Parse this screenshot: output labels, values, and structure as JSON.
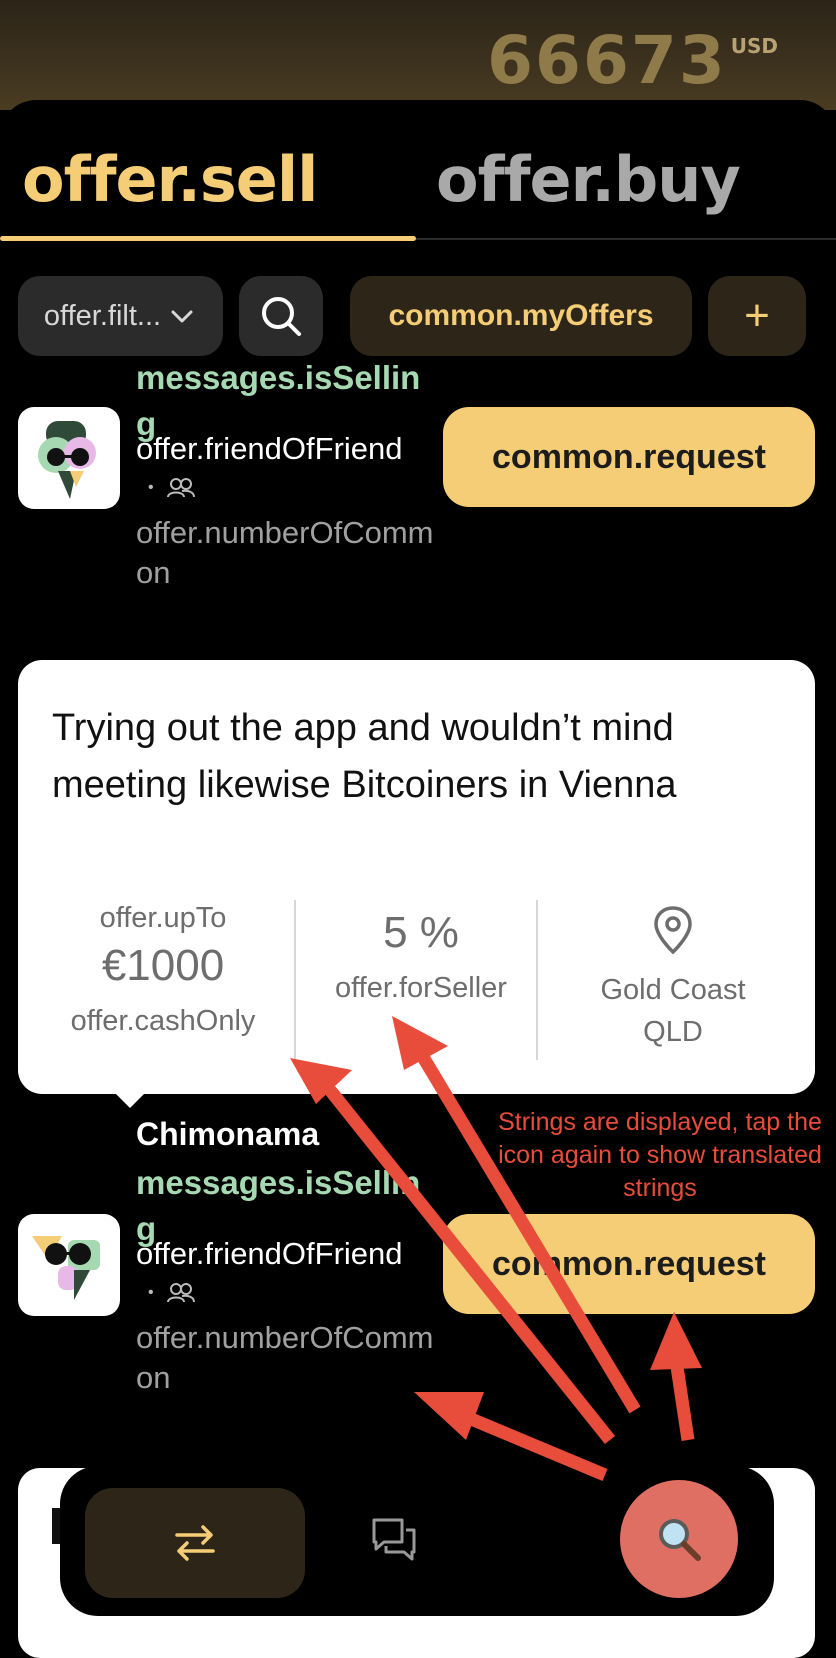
{
  "header": {
    "balance_amount": "66673",
    "balance_currency": "USD"
  },
  "tabs": {
    "sell": "offer.sell",
    "buy": "offer.buy",
    "active": "sell"
  },
  "toolbar": {
    "filter_label": "offer.filt...",
    "my_offers_label": "common.myOffers",
    "add_label": "+"
  },
  "offers": [
    {
      "selling": "messages.isSelling",
      "friend_of_friend": "offer.friendOfFriend",
      "number_of_common": "offer.numberOfCommon",
      "request_label": "common.request"
    },
    {
      "seller_name": "Chimonama",
      "selling": "messages.isSelling",
      "friend_of_friend": "offer.friendOfFriend",
      "number_of_common": "offer.numberOfCommon",
      "request_label": "common.request"
    }
  ],
  "offer_card": {
    "description": "Trying out the app and wouldn’t mind meeting likewise Bitcoiners in Vienna",
    "up_to_label": "offer.upTo",
    "amount": "€1000",
    "cash_only": "offer.cashOnly",
    "fee": "5 %",
    "for_seller": "offer.forSeller",
    "location": "Gold Coast QLD"
  },
  "annotation": {
    "text": "Strings are displayed, tap the icon again to show translated strings"
  },
  "colors": {
    "accent": "#f4cd76",
    "selling_text": "#a6d9b1",
    "fab": "#e06f63",
    "arrow": "#e84c3a"
  },
  "icons": {
    "search": "search-icon",
    "chevron": "chevron-down-icon",
    "location": "location-pin-icon",
    "swap": "swap-icon",
    "chat": "chat-icon",
    "magnifier": "magnifier-icon"
  }
}
